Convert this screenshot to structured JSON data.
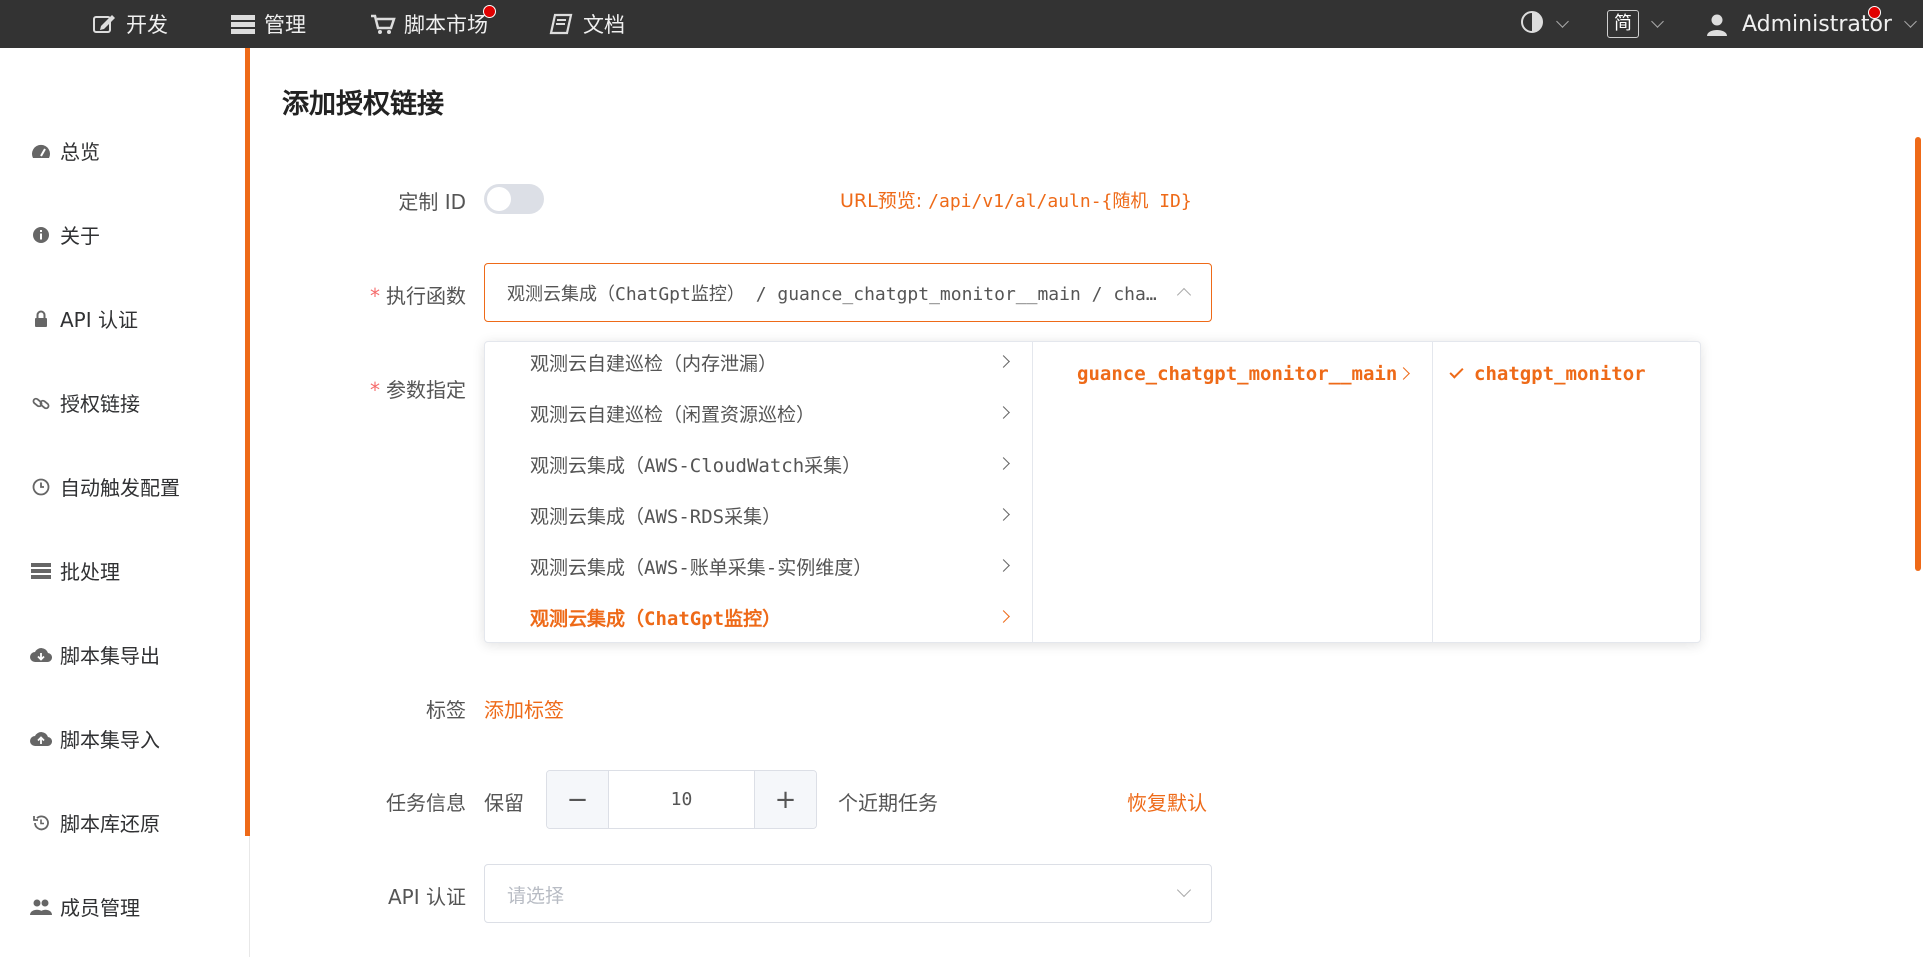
{
  "topbar": {
    "nav": [
      {
        "label": "开发",
        "icon": "edit-icon"
      },
      {
        "label": "管理",
        "icon": "server-icon"
      },
      {
        "label": "脚本市场",
        "icon": "cart-icon"
      },
      {
        "label": "文档",
        "icon": "book-icon"
      }
    ],
    "lang": "简",
    "user": "Administrator"
  },
  "sidebar": {
    "items": [
      {
        "label": "总览",
        "icon": "dashboard-icon"
      },
      {
        "label": "关于",
        "icon": "info-icon"
      },
      {
        "label": "API 认证",
        "icon": "lock-icon"
      },
      {
        "label": "授权链接",
        "icon": "link-icon"
      },
      {
        "label": "自动触发配置",
        "icon": "clock-icon"
      },
      {
        "label": "批处理",
        "icon": "server-icon"
      },
      {
        "label": "脚本集导出",
        "icon": "cloud-download-icon"
      },
      {
        "label": "脚本集导入",
        "icon": "cloud-upload-icon"
      },
      {
        "label": "脚本库还原",
        "icon": "history-icon"
      },
      {
        "label": "成员管理",
        "icon": "users-icon"
      }
    ]
  },
  "page": {
    "title": "添加授权链接",
    "custom_id_label": "定制 ID",
    "url_preview_label": "URL预览:",
    "url_preview_path": "/api/v1/al/auln-{随机 ID}",
    "func_label": "执行函数",
    "func_value": "观测云集成（ChatGpt监控） / guance_chatgpt_monitor__main / chatgpt_monitor",
    "params_label": "参数指定",
    "tags_label": "标签",
    "add_tag": "添加标签",
    "task_label": "任务信息",
    "keep": "保留",
    "task_count": "10",
    "recent_tasks": "个近期任务",
    "restore_default": "恢复默认",
    "api_auth_label": "API 认证",
    "api_auth_placeholder": "请选择"
  },
  "cascader": {
    "col1": [
      "观测云自建巡检（内存泄漏）",
      "观测云自建巡检（闲置资源巡检）",
      "观测云集成（AWS-CloudWatch采集）",
      "观测云集成（AWS-RDS采集）",
      "观测云集成（AWS-账单采集-实例维度）",
      "观测云集成（ChatGpt监控）"
    ],
    "col2": [
      "guance_chatgpt_monitor__main"
    ],
    "col3": [
      "chatgpt_monitor"
    ]
  },
  "colors": {
    "accent": "#ee6a18",
    "topbar": "#333333",
    "required": "#f56c6c"
  }
}
